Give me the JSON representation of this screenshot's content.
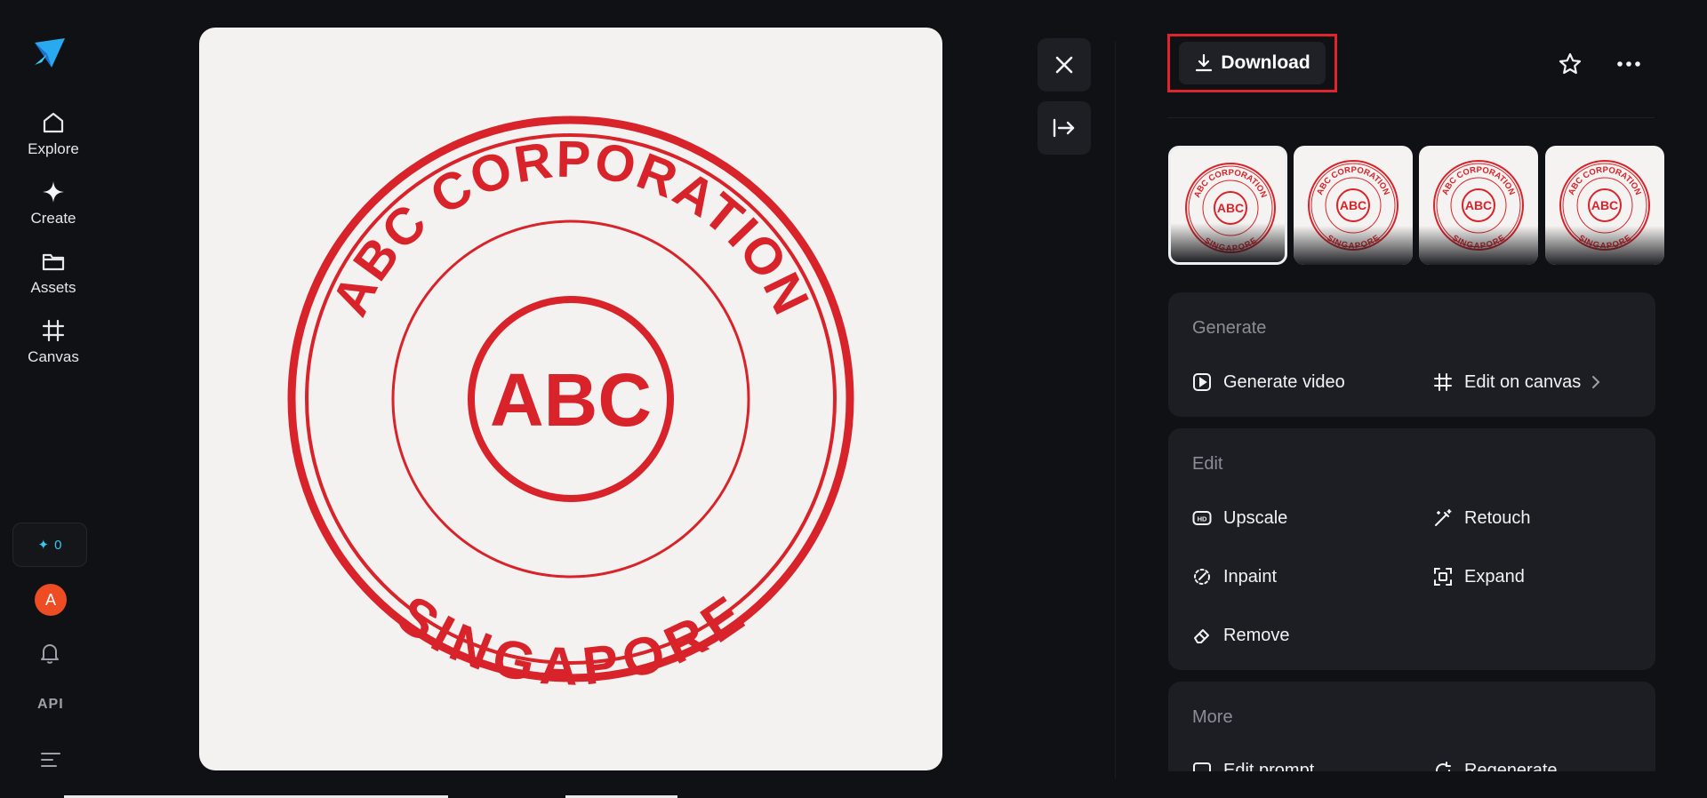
{
  "sidebar": {
    "items": [
      {
        "label": "Explore",
        "icon": "home-icon"
      },
      {
        "label": "Create",
        "icon": "sparkle-icon"
      },
      {
        "label": "Assets",
        "icon": "folder-icon"
      },
      {
        "label": "Canvas",
        "icon": "canvas-grid-icon"
      }
    ],
    "credits": "0",
    "avatar_initial": "A",
    "api_label": "API"
  },
  "image": {
    "stamp_top_text": "ABC CORPORATION",
    "stamp_center_text": "ABC",
    "stamp_bottom_text": "SINGAPORE",
    "stamp_color": "#d8232a"
  },
  "toolbar": {
    "download_label": "Download"
  },
  "variants": {
    "count": 4,
    "selected_index": 0
  },
  "generate": {
    "title": "Generate",
    "actions": [
      {
        "label": "Generate video",
        "icon": "play-square-icon"
      },
      {
        "label": "Edit on canvas",
        "icon": "canvas-grid-icon"
      }
    ]
  },
  "edit": {
    "title": "Edit",
    "actions": [
      {
        "label": "Upscale",
        "icon": "hd-icon"
      },
      {
        "label": "Retouch",
        "icon": "magic-wand-icon"
      },
      {
        "label": "Inpaint",
        "icon": "inpaint-icon"
      },
      {
        "label": "Expand",
        "icon": "expand-icon"
      },
      {
        "label": "Remove",
        "icon": "eraser-icon"
      }
    ]
  },
  "more": {
    "title": "More",
    "actions": [
      {
        "label": "Edit prompt",
        "icon": "edit-prompt-icon"
      },
      {
        "label": "Regenerate",
        "icon": "regenerate-icon"
      }
    ]
  },
  "colors": {
    "background": "#101114",
    "card": "#1d1e23",
    "accent_cyan": "#35c8ee",
    "highlight_red": "#e0242e",
    "avatar": "#ee4d24"
  }
}
